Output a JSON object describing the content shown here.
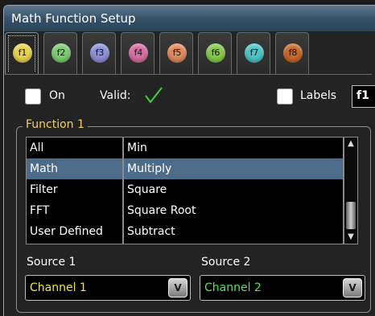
{
  "window": {
    "title": "Math Function Setup"
  },
  "tabs": [
    {
      "label": "f1",
      "color": "#e6d44f",
      "active": true
    },
    {
      "label": "f2",
      "color": "#7ecb71",
      "active": false
    },
    {
      "label": "f3",
      "color": "#8e8fd8",
      "active": false
    },
    {
      "label": "f4",
      "color": "#d86ea0",
      "active": false
    },
    {
      "label": "f5",
      "color": "#e08a5c",
      "active": false
    },
    {
      "label": "f6",
      "color": "#86c94a",
      "active": false
    },
    {
      "label": "f7",
      "color": "#4ec4c4",
      "active": false
    },
    {
      "label": "f8",
      "color": "#c8692a",
      "active": false
    }
  ],
  "controls": {
    "on_label": "On",
    "valid_label": "Valid:",
    "valid_icon": "checkmark-icon",
    "labels_label": "Labels",
    "labels_value": "f1"
  },
  "function_group": {
    "title": "Function 1",
    "categories": [
      "All",
      "Math",
      "Filter",
      "FFT",
      "User Defined"
    ],
    "selected_category": "Math",
    "functions": [
      "Min",
      "Multiply",
      "Square",
      "Square Root",
      "Subtract"
    ],
    "selected_function": "Multiply"
  },
  "sources": {
    "source1_label": "Source 1",
    "source1_value": "Channel 1",
    "source1_color": "#f2e640",
    "source2_label": "Source 2",
    "source2_value": "Channel 2",
    "source2_color": "#5ce05c"
  },
  "accent_colors": {
    "selection": "#4c6c89",
    "group_title": "#f0d060",
    "valid_check": "#3fcf3f"
  }
}
